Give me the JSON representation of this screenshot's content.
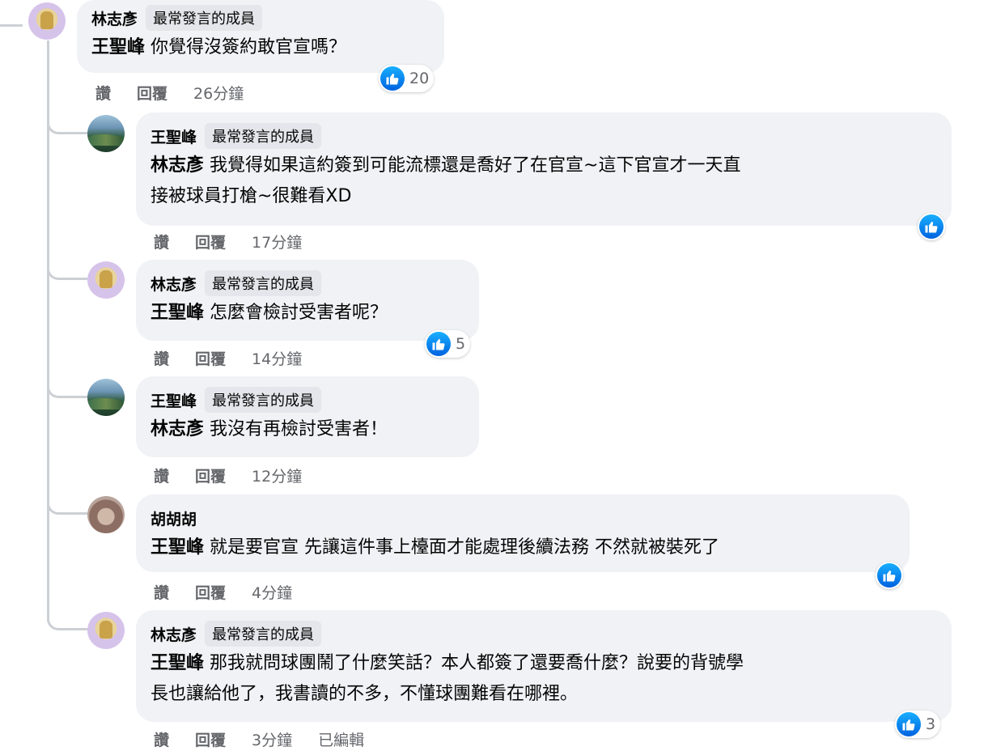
{
  "comments": [
    {
      "author": "林志彥",
      "badge": "最常發言的成員",
      "mention": "王聖峰",
      "text_lines": [
        "你覺得沒簽約敢官宣嗎？"
      ],
      "actions": {
        "like": "讚",
        "reply": "回覆",
        "time": "26分鐘"
      },
      "reaction_count": "20",
      "avatar": "gold-statue-avatar"
    },
    {
      "author": "王聖峰",
      "badge": "最常發言的成員",
      "mention": "林志彥",
      "text_lines": [
        "我覺得如果這約簽到可能流標還是喬好了在官宣~這下官宣才一天直",
        "接被球員打槍~很難看XD"
      ],
      "actions": {
        "like": "讚",
        "reply": "回覆",
        "time": "17分鐘"
      },
      "reaction_count": "",
      "avatar": "landscape-avatar"
    },
    {
      "author": "林志彥",
      "badge": "最常發言的成員",
      "mention": "王聖峰",
      "text_lines": [
        "怎麼會檢討受害者呢？"
      ],
      "actions": {
        "like": "讚",
        "reply": "回覆",
        "time": "14分鐘"
      },
      "reaction_count": "5",
      "avatar": "gold-statue-avatar"
    },
    {
      "author": "王聖峰",
      "badge": "最常發言的成員",
      "mention": "林志彥",
      "text_lines": [
        "我沒有再檢討受害者！"
      ],
      "actions": {
        "like": "讚",
        "reply": "回覆",
        "time": "12分鐘"
      },
      "reaction_count": "",
      "avatar": "landscape-avatar"
    },
    {
      "author": "胡胡胡",
      "badge": "",
      "mention": "王聖峰",
      "text_lines": [
        "就是要官宣 先讓這件事上檯面才能處理後續法務 不然就被裝死了"
      ],
      "actions": {
        "like": "讚",
        "reply": "回覆",
        "time": "4分鐘"
      },
      "reaction_count": "",
      "avatar": "cat-avatar"
    },
    {
      "author": "林志彥",
      "badge": "最常發言的成員",
      "mention": "王聖峰",
      "text_lines": [
        "那我就問球團鬧了什麼笑話？本人都簽了還要喬什麼？說要的背號學",
        "長也讓給他了，我書讀的不多，不懂球團難看在哪裡。"
      ],
      "actions": {
        "like": "讚",
        "reply": "回覆",
        "time": "3分鐘",
        "edited": "已編輯"
      },
      "reaction_count": "3",
      "avatar": "gold-statue-avatar"
    }
  ],
  "colors": {
    "like_blue": "#0866ff",
    "bubble": "#f0f2f5",
    "meta_gray": "#65676b",
    "thread": "#ccd0d5"
  }
}
